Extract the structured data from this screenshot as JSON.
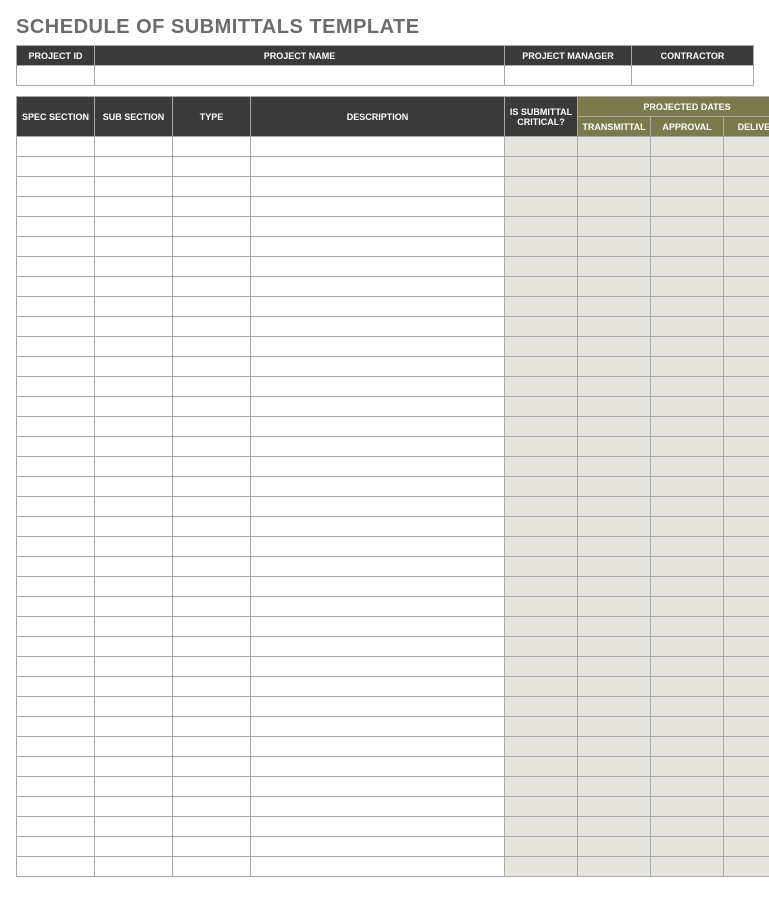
{
  "title": "SCHEDULE OF SUBMITTALS TEMPLATE",
  "projectHeader": {
    "projectId": {
      "label": "PROJECT ID",
      "value": ""
    },
    "projectName": {
      "label": "PROJECT NAME",
      "value": ""
    },
    "projectManager": {
      "label": "PROJECT MANAGER",
      "value": ""
    },
    "contractor": {
      "label": "CONTRACTOR",
      "value": ""
    }
  },
  "columns": {
    "specSection": "SPEC SECTION",
    "subSection": "SUB SECTION",
    "type": "TYPE",
    "description": "DESCRIPTION",
    "isCritical": "IS SUBMITTAL CRITICAL?",
    "projectedDates": "PROJECTED DATES",
    "transmittal": "TRANSMITTAL",
    "approval": "APPROVAL",
    "delivery": "DELIVERY"
  },
  "rows": [
    {
      "specSection": "",
      "subSection": "",
      "type": "",
      "description": "",
      "isCritical": "",
      "transmittal": "",
      "approval": "",
      "delivery": ""
    },
    {
      "specSection": "",
      "subSection": "",
      "type": "",
      "description": "",
      "isCritical": "",
      "transmittal": "",
      "approval": "",
      "delivery": ""
    },
    {
      "specSection": "",
      "subSection": "",
      "type": "",
      "description": "",
      "isCritical": "",
      "transmittal": "",
      "approval": "",
      "delivery": ""
    },
    {
      "specSection": "",
      "subSection": "",
      "type": "",
      "description": "",
      "isCritical": "",
      "transmittal": "",
      "approval": "",
      "delivery": ""
    },
    {
      "specSection": "",
      "subSection": "",
      "type": "",
      "description": "",
      "isCritical": "",
      "transmittal": "",
      "approval": "",
      "delivery": ""
    },
    {
      "specSection": "",
      "subSection": "",
      "type": "",
      "description": "",
      "isCritical": "",
      "transmittal": "",
      "approval": "",
      "delivery": ""
    },
    {
      "specSection": "",
      "subSection": "",
      "type": "",
      "description": "",
      "isCritical": "",
      "transmittal": "",
      "approval": "",
      "delivery": ""
    },
    {
      "specSection": "",
      "subSection": "",
      "type": "",
      "description": "",
      "isCritical": "",
      "transmittal": "",
      "approval": "",
      "delivery": ""
    },
    {
      "specSection": "",
      "subSection": "",
      "type": "",
      "description": "",
      "isCritical": "",
      "transmittal": "",
      "approval": "",
      "delivery": ""
    },
    {
      "specSection": "",
      "subSection": "",
      "type": "",
      "description": "",
      "isCritical": "",
      "transmittal": "",
      "approval": "",
      "delivery": ""
    },
    {
      "specSection": "",
      "subSection": "",
      "type": "",
      "description": "",
      "isCritical": "",
      "transmittal": "",
      "approval": "",
      "delivery": ""
    },
    {
      "specSection": "",
      "subSection": "",
      "type": "",
      "description": "",
      "isCritical": "",
      "transmittal": "",
      "approval": "",
      "delivery": ""
    },
    {
      "specSection": "",
      "subSection": "",
      "type": "",
      "description": "",
      "isCritical": "",
      "transmittal": "",
      "approval": "",
      "delivery": ""
    },
    {
      "specSection": "",
      "subSection": "",
      "type": "",
      "description": "",
      "isCritical": "",
      "transmittal": "",
      "approval": "",
      "delivery": ""
    },
    {
      "specSection": "",
      "subSection": "",
      "type": "",
      "description": "",
      "isCritical": "",
      "transmittal": "",
      "approval": "",
      "delivery": ""
    },
    {
      "specSection": "",
      "subSection": "",
      "type": "",
      "description": "",
      "isCritical": "",
      "transmittal": "",
      "approval": "",
      "delivery": ""
    },
    {
      "specSection": "",
      "subSection": "",
      "type": "",
      "description": "",
      "isCritical": "",
      "transmittal": "",
      "approval": "",
      "delivery": ""
    },
    {
      "specSection": "",
      "subSection": "",
      "type": "",
      "description": "",
      "isCritical": "",
      "transmittal": "",
      "approval": "",
      "delivery": ""
    },
    {
      "specSection": "",
      "subSection": "",
      "type": "",
      "description": "",
      "isCritical": "",
      "transmittal": "",
      "approval": "",
      "delivery": ""
    },
    {
      "specSection": "",
      "subSection": "",
      "type": "",
      "description": "",
      "isCritical": "",
      "transmittal": "",
      "approval": "",
      "delivery": ""
    },
    {
      "specSection": "",
      "subSection": "",
      "type": "",
      "description": "",
      "isCritical": "",
      "transmittal": "",
      "approval": "",
      "delivery": ""
    },
    {
      "specSection": "",
      "subSection": "",
      "type": "",
      "description": "",
      "isCritical": "",
      "transmittal": "",
      "approval": "",
      "delivery": ""
    },
    {
      "specSection": "",
      "subSection": "",
      "type": "",
      "description": "",
      "isCritical": "",
      "transmittal": "",
      "approval": "",
      "delivery": ""
    },
    {
      "specSection": "",
      "subSection": "",
      "type": "",
      "description": "",
      "isCritical": "",
      "transmittal": "",
      "approval": "",
      "delivery": ""
    },
    {
      "specSection": "",
      "subSection": "",
      "type": "",
      "description": "",
      "isCritical": "",
      "transmittal": "",
      "approval": "",
      "delivery": ""
    },
    {
      "specSection": "",
      "subSection": "",
      "type": "",
      "description": "",
      "isCritical": "",
      "transmittal": "",
      "approval": "",
      "delivery": ""
    },
    {
      "specSection": "",
      "subSection": "",
      "type": "",
      "description": "",
      "isCritical": "",
      "transmittal": "",
      "approval": "",
      "delivery": ""
    },
    {
      "specSection": "",
      "subSection": "",
      "type": "",
      "description": "",
      "isCritical": "",
      "transmittal": "",
      "approval": "",
      "delivery": ""
    },
    {
      "specSection": "",
      "subSection": "",
      "type": "",
      "description": "",
      "isCritical": "",
      "transmittal": "",
      "approval": "",
      "delivery": ""
    },
    {
      "specSection": "",
      "subSection": "",
      "type": "",
      "description": "",
      "isCritical": "",
      "transmittal": "",
      "approval": "",
      "delivery": ""
    },
    {
      "specSection": "",
      "subSection": "",
      "type": "",
      "description": "",
      "isCritical": "",
      "transmittal": "",
      "approval": "",
      "delivery": ""
    },
    {
      "specSection": "",
      "subSection": "",
      "type": "",
      "description": "",
      "isCritical": "",
      "transmittal": "",
      "approval": "",
      "delivery": ""
    },
    {
      "specSection": "",
      "subSection": "",
      "type": "",
      "description": "",
      "isCritical": "",
      "transmittal": "",
      "approval": "",
      "delivery": ""
    },
    {
      "specSection": "",
      "subSection": "",
      "type": "",
      "description": "",
      "isCritical": "",
      "transmittal": "",
      "approval": "",
      "delivery": ""
    },
    {
      "specSection": "",
      "subSection": "",
      "type": "",
      "description": "",
      "isCritical": "",
      "transmittal": "",
      "approval": "",
      "delivery": ""
    },
    {
      "specSection": "",
      "subSection": "",
      "type": "",
      "description": "",
      "isCritical": "",
      "transmittal": "",
      "approval": "",
      "delivery": ""
    },
    {
      "specSection": "",
      "subSection": "",
      "type": "",
      "description": "",
      "isCritical": "",
      "transmittal": "",
      "approval": "",
      "delivery": ""
    }
  ]
}
